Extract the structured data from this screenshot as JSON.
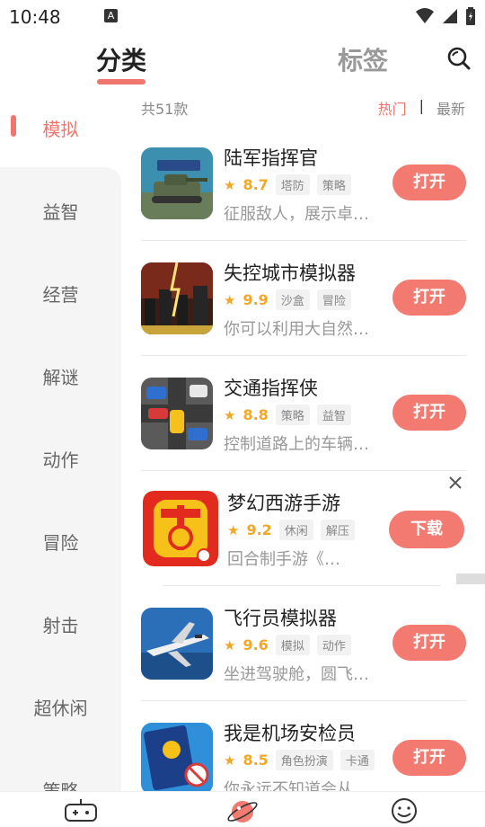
{
  "status": {
    "time": "10:48",
    "badge": "A"
  },
  "header": {
    "tab_active": "分类",
    "tab_inactive": "标签"
  },
  "sidebar": {
    "active": "模拟",
    "items": [
      "益智",
      "经营",
      "解谜",
      "动作",
      "冒险",
      "射击",
      "超休闲",
      "策略"
    ]
  },
  "list": {
    "count": "共51款",
    "sort_hot": "热门",
    "sort_sep": "|",
    "sort_new": "最新",
    "games": [
      {
        "name": "陆军指挥官",
        "score": "8.7",
        "tags": [
          "塔防",
          "策略"
        ],
        "desc": "征服敌人，展示卓…",
        "button": "打开"
      },
      {
        "name": "失控城市模拟器",
        "score": "9.9",
        "tags": [
          "沙盒",
          "冒险"
        ],
        "desc": "你可以利用大自然…",
        "button": "打开"
      },
      {
        "name": "交通指挥侠",
        "score": "8.8",
        "tags": [
          "策略",
          "益智"
        ],
        "desc": "控制道路上的车辆…",
        "button": "打开"
      },
      {
        "name": "梦幻西游手游",
        "score": "9.2",
        "tags": [
          "休闲",
          "解压"
        ],
        "desc": "回合制手游《…",
        "button": "下载"
      },
      {
        "name": "飞行员模拟器",
        "score": "9.6",
        "tags": [
          "模拟",
          "动作"
        ],
        "desc": "坐进驾驶舱，圆飞…",
        "button": "打开"
      },
      {
        "name": "我是机场安检员",
        "score": "8.5",
        "tags": [
          "角色扮演",
          "卡通"
        ],
        "desc": "你永远不知道会从…",
        "button": "打开"
      }
    ]
  },
  "colors": {
    "accent": "#f0766d",
    "star": "#f5a623",
    "sidebar_bg": "#f5f5f5"
  },
  "icons": [
    "wifi-icon",
    "signal-icon",
    "battery-icon",
    "search-icon",
    "close-icon",
    "gamepad-icon",
    "planet-icon",
    "smiley-icon"
  ]
}
